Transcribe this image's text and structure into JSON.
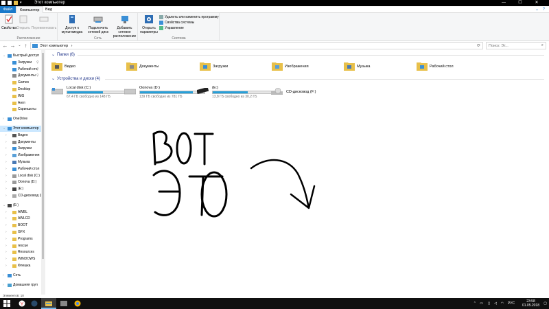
{
  "window": {
    "title": "Этот компьютер"
  },
  "ribbon_tabs": [
    "Файл",
    "Компьютер",
    "Вид"
  ],
  "ribbon": {
    "groups": [
      {
        "label": "Расположение",
        "buttons": [
          "Свойства",
          "Открыть",
          "Переименовать"
        ]
      },
      {
        "label": "Сеть",
        "buttons": [
          "Доступ к мультимедиа",
          "Подключить сетевой диск",
          "Добавить сетевое расположение"
        ]
      },
      {
        "label": "Система",
        "buttons": [
          "Открыть параметры"
        ]
      }
    ],
    "system_links": [
      "Удалить или изменить программу",
      "Свойства системы",
      "Управление"
    ]
  },
  "address": {
    "path": "Этот компьютер",
    "search_placeholder": "Поиск: Эт..."
  },
  "sidebar": {
    "items": [
      {
        "label": "Быстрый доступ",
        "level": 0
      },
      {
        "label": "Загрузки",
        "level": 1,
        "pinned": true
      },
      {
        "label": "Рабочий сто",
        "level": 1,
        "pinned": true
      },
      {
        "label": "Документы",
        "level": 1,
        "pinned": true
      },
      {
        "label": "Games",
        "level": 1
      },
      {
        "label": "Desktop",
        "level": 1
      },
      {
        "label": "IMG",
        "level": 1
      },
      {
        "label": "Англ",
        "level": 1
      },
      {
        "label": "Скриншоты",
        "level": 1
      },
      {
        "label": "OneDrive",
        "level": 0
      },
      {
        "label": "Этот компьютер",
        "level": 0,
        "selected": true
      },
      {
        "label": "Видео",
        "level": 1
      },
      {
        "label": "Документы",
        "level": 1
      },
      {
        "label": "Загрузки",
        "level": 1
      },
      {
        "label": "Изображения",
        "level": 1
      },
      {
        "label": "Музыка",
        "level": 1
      },
      {
        "label": "Рабочий стол",
        "level": 1
      },
      {
        "label": "Local disk  (C:)",
        "level": 1
      },
      {
        "label": "Oonova (D:)",
        "level": 1
      },
      {
        "label": "(E:)",
        "level": 1
      },
      {
        "label": "CD-дисковод (F",
        "level": 1
      },
      {
        "label": "(E:)",
        "level": 0
      },
      {
        "label": "AWBL",
        "level": 1
      },
      {
        "label": "AWLCD",
        "level": 1
      },
      {
        "label": "BOOT",
        "level": 1
      },
      {
        "label": "GFX",
        "level": 1
      },
      {
        "label": "Programs",
        "level": 1
      },
      {
        "label": "rescue",
        "level": 1
      },
      {
        "label": "Resources",
        "level": 1
      },
      {
        "label": "WINDOWS",
        "level": 1
      },
      {
        "label": "Флешка",
        "level": 1
      },
      {
        "label": "Сеть",
        "level": 0
      },
      {
        "label": "Домашняя груп",
        "level": 0
      }
    ]
  },
  "main": {
    "folders_header": "Папки (6)",
    "folders": [
      "Видео",
      "Документы",
      "Загрузки",
      "Изображения",
      "Музыка",
      "Рабочий стол"
    ],
    "drives_header": "Устройства и диски (4)",
    "drives": [
      {
        "name": "Local disk  (C:)",
        "free": "67,4 ГБ свободно из 148 ГБ",
        "used_fraction": 0.55
      },
      {
        "name": "Oonova (D:)",
        "free": "139 ГБ свободно из 781 ГБ",
        "used_fraction": 0.82
      },
      {
        "name": "(E:)",
        "free": "13,8 ГБ свободно из 30,2 ГБ",
        "used_fraction": 0.54
      },
      {
        "name": "CD-дисковод (F:)",
        "free": "",
        "used_fraction": null
      }
    ],
    "handwriting_line1": "ВОТ",
    "handwriting_line2": "ЭТО"
  },
  "status": {
    "items_count": "Элементов: 10"
  },
  "taskbar": {
    "lang": "РУС",
    "time": "23:58",
    "date": "01.05.2018"
  },
  "colors": {
    "accent": "#1979ca",
    "drive_fill": "#26a0da",
    "folder": "#e8c04a",
    "selected": "#cce8ff"
  }
}
